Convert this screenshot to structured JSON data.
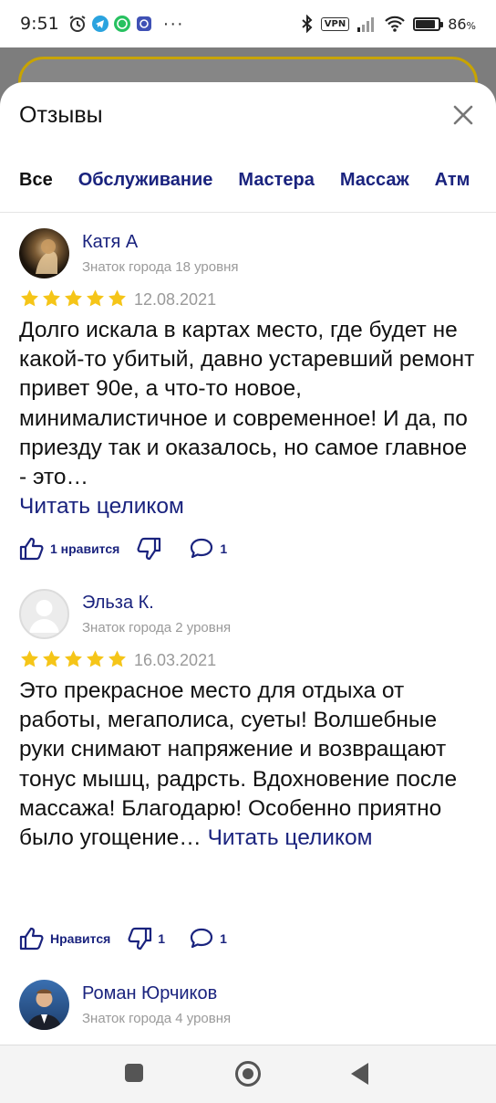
{
  "status_bar": {
    "time": "9:51",
    "vpn": "VPN",
    "battery": "86",
    "battery_suffix": "%",
    "battery_level": 0.86,
    "overflow": "···"
  },
  "sheet": {
    "title": "Отзывы",
    "tabs": [
      "Все",
      "Обслуживание",
      "Мастера",
      "Массаж",
      "Атм"
    ]
  },
  "reviews": [
    {
      "author": "Катя А",
      "level": "Знаток города 18 уровня",
      "rating": 5,
      "date": "12.08.2021",
      "text": "Долго искала в картах место, где будет не какой-то убитый, давно устаревший ремонт привет 90е, а что-то новое, минималистичное и современное! И да, по приезду так и оказалось, но самое главное - это…",
      "read_more": "Читать целиком",
      "like_label": "1 нравится",
      "dislike_count": "",
      "comment_count": "1"
    },
    {
      "author": "Эльза К.",
      "level": "Знаток города 2 уровня",
      "rating": 5,
      "date": "16.03.2021",
      "text": "Это прекрасное место для отдыха от работы, мегаполиса, суеты! Волшебные руки снимают напряжение и возвращают тонус мышц, радрсть. Вдохновение после массажа! Благодарю! Особенно приятно было угощение…",
      "read_more": "Читать целиком",
      "like_label": "Нравится",
      "dislike_count": "1",
      "comment_count": "1"
    },
    {
      "author": "Роман Юрчиков",
      "level": "Знаток города 4 уровня"
    }
  ],
  "colors": {
    "link": "#1a237e",
    "star": "#f5c518",
    "secondary_text": "#9a9a9a",
    "accent_border": "#c8a400"
  }
}
